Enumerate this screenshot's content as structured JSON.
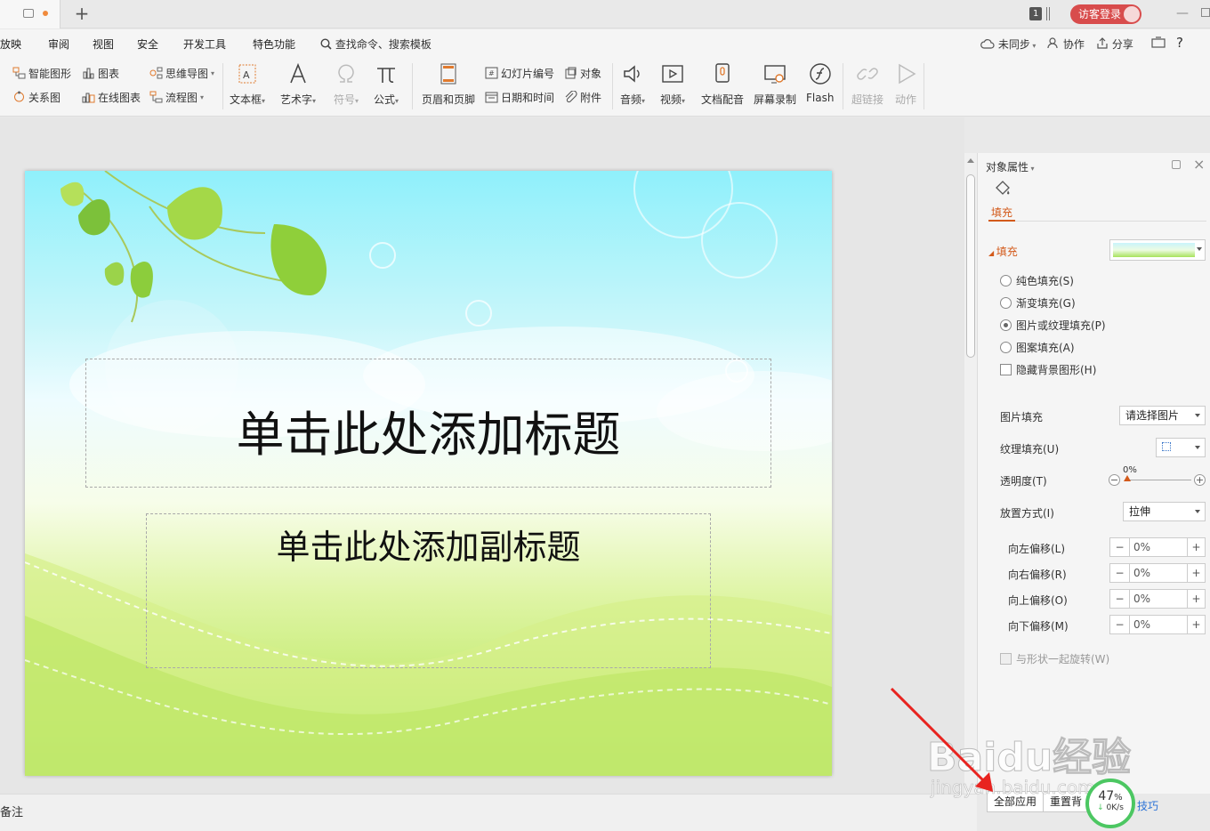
{
  "titlebar": {
    "window_number": "1",
    "login_label": "访客登录"
  },
  "menu": {
    "items": [
      "放映",
      "审阅",
      "视图",
      "安全",
      "开发工具",
      "特色功能"
    ],
    "search_label": "查找命令、搜索模板",
    "sync_label": "未同步",
    "collab_label": "协作",
    "share_label": "分享",
    "help_label": "?"
  },
  "ribbon": {
    "smart_shape": "智能图形",
    "chart": "图表",
    "mindmap": "思维导图",
    "relation": "关系图",
    "online_chart": "在线图表",
    "flowchart": "流程图",
    "textbox": "文本框",
    "wordart": "艺术字",
    "symbol": "符号",
    "formula": "公式",
    "header_footer": "页眉和页脚",
    "slide_number": "幻灯片编号",
    "object": "对象",
    "datetime": "日期和时间",
    "attachment": "附件",
    "audio": "音频",
    "video": "视频",
    "doc_voice": "文档配音",
    "screen_record": "屏幕录制",
    "flash": "Flash",
    "hyperlink": "超链接",
    "action": "动作"
  },
  "slide": {
    "title_placeholder": "单击此处添加标题",
    "subtitle_placeholder": "单击此处添加副标题",
    "colors": {
      "sky": "#8ff0fb",
      "grass": "#8ee24b"
    }
  },
  "panel": {
    "title": "对象属性",
    "tab_fill": "填充",
    "section_fill": "填充",
    "options": [
      {
        "label": "纯色填充(S)",
        "selected": false
      },
      {
        "label": "渐变填充(G)",
        "selected": false
      },
      {
        "label": "图片或纹理填充(P)",
        "selected": true
      },
      {
        "label": "图案填充(A)",
        "selected": false
      }
    ],
    "hide_bg_label": "隐藏背景图形(H)",
    "picture_fill_label": "图片填充",
    "picture_fill_value": "请选择图片",
    "texture_fill_label": "纹理填充(U)",
    "transparency_label": "透明度(T)",
    "transparency_value": "0%",
    "placement_label": "放置方式(I)",
    "placement_value": "拉伸",
    "offsets": [
      {
        "label": "向左偏移(L)",
        "value": "0%"
      },
      {
        "label": "向右偏移(R)",
        "value": "0%"
      },
      {
        "label": "向上偏移(O)",
        "value": "0%"
      },
      {
        "label": "向下偏移(M)",
        "value": "0%"
      }
    ],
    "rotate_with_shape_label": "与形状一起旋转(W)",
    "apply_all_label": "全部应用",
    "reset_bg_label": "重置背",
    "tips_label": "技巧",
    "accent_color": "#d35a1b"
  },
  "status": {
    "notes_label": "备注"
  },
  "speed": {
    "percent": "47",
    "percent_unit": "%",
    "rate": "0K/s"
  },
  "watermark": {
    "brand": "Baidu经验",
    "url": "jingyan.baidu.com"
  }
}
